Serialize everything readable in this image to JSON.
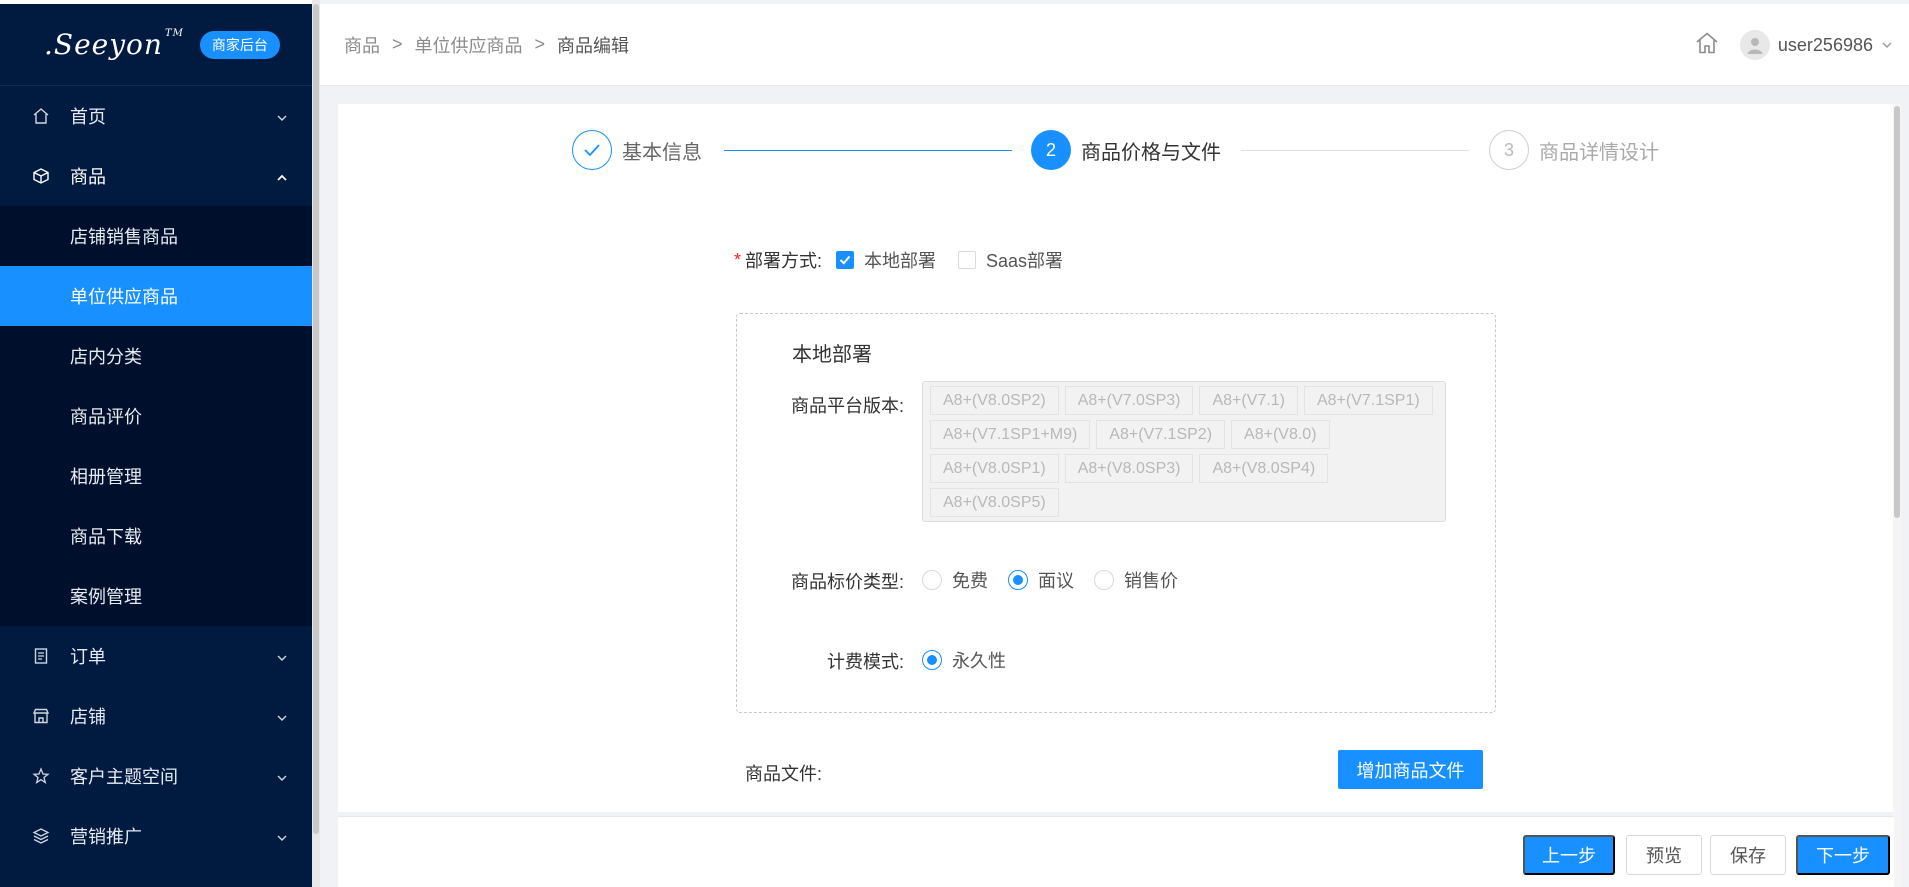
{
  "brand": {
    "logo_text": ".Seeyon",
    "logo_tm": "TM",
    "badge": "商家后台"
  },
  "sidebar": {
    "items": [
      {
        "label": "首页",
        "icon": "home-icon",
        "expanded": false
      },
      {
        "label": "商品",
        "icon": "cube-icon",
        "expanded": true
      },
      {
        "label": "订单",
        "icon": "document-icon",
        "expanded": false
      },
      {
        "label": "店铺",
        "icon": "store-icon",
        "expanded": false
      },
      {
        "label": "客户主题空间",
        "icon": "star-icon",
        "expanded": false
      },
      {
        "label": "营销推广",
        "icon": "layers-icon",
        "expanded": false
      }
    ],
    "submenu": [
      {
        "label": "店铺销售商品",
        "active": false
      },
      {
        "label": "单位供应商品",
        "active": true
      },
      {
        "label": "店内分类",
        "active": false
      },
      {
        "label": "商品评价",
        "active": false
      },
      {
        "label": "相册管理",
        "active": false
      },
      {
        "label": "商品下载",
        "active": false
      },
      {
        "label": "案例管理",
        "active": false
      }
    ]
  },
  "header": {
    "breadcrumb": [
      "商品",
      "单位供应商品",
      "商品编辑"
    ],
    "separator": ">",
    "username": "user256986"
  },
  "steps": [
    {
      "number": "✓",
      "label": "基本信息",
      "state": "done"
    },
    {
      "number": "2",
      "label": "商品价格与文件",
      "state": "active"
    },
    {
      "number": "3",
      "label": "商品详情设计",
      "state": "pending"
    }
  ],
  "form": {
    "deploy_label": "部署方式:",
    "required_mark": "*",
    "deploy_options": [
      {
        "label": "本地部署",
        "checked": true
      },
      {
        "label": "Saas部署",
        "checked": false
      }
    ],
    "section_title": "本地部署",
    "version_label": "商品平台版本:",
    "versions": [
      "A8+(V8.0SP2)",
      "A8+(V7.0SP3)",
      "A8+(V7.1)",
      "A8+(V7.1SP1)",
      "A8+(V7.1SP1+M9)",
      "A8+(V7.1SP2)",
      "A8+(V8.0)",
      "A8+(V8.0SP1)",
      "A8+(V8.0SP3)",
      "A8+(V8.0SP4)",
      "A8+(V8.0SP5)"
    ],
    "price_type_label": "商品标价类型:",
    "price_types": [
      {
        "label": "免费",
        "selected": false
      },
      {
        "label": "面议",
        "selected": true
      },
      {
        "label": "销售价",
        "selected": false
      }
    ],
    "billing_label": "计费模式:",
    "billing_modes": [
      {
        "label": "永久性",
        "selected": true
      }
    ],
    "file_label": "商品文件:",
    "add_file_button": "增加商品文件"
  },
  "footer": {
    "prev": "上一步",
    "preview": "预览",
    "save": "保存",
    "next": "下一步"
  },
  "colors": {
    "sidebar_bg": "#001a40",
    "accent": "#1890ff",
    "submenu_bg": "#000f2b"
  }
}
